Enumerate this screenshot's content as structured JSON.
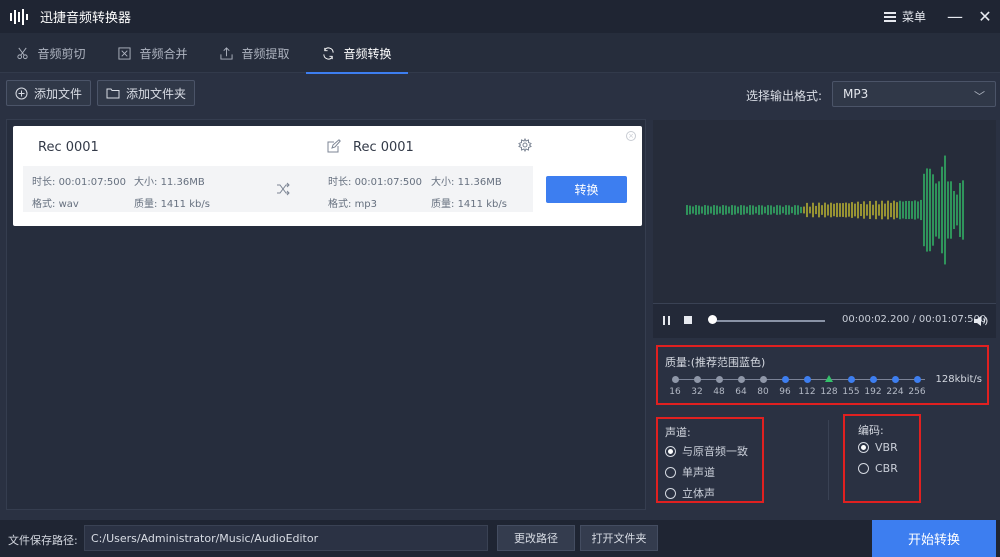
{
  "app": {
    "title": "迅捷音频转换器",
    "menu_label": "菜单",
    "minimize": "—",
    "close": "✕"
  },
  "tabs": [
    {
      "label": "音频剪切",
      "icon": "scissors-icon"
    },
    {
      "label": "音频合并",
      "icon": "merge-icon"
    },
    {
      "label": "音频提取",
      "icon": "extract-icon"
    },
    {
      "label": "音频转换",
      "icon": "convert-icon",
      "active": true
    }
  ],
  "toolbar": {
    "add_file": "添加文件",
    "add_folder": "添加文件夹",
    "format_label": "选择输出格式:",
    "format_value": "MP3"
  },
  "file": {
    "src_name": "Rec 0001",
    "dst_name": "Rec 0001",
    "src": {
      "duration_label": "时长:",
      "duration": "00:01:07:500",
      "size_label": "大小:",
      "size": "11.36MB",
      "format_label": "格式:",
      "format": "wav",
      "quality_label": "质量:",
      "quality": "1411 kb/s"
    },
    "dst": {
      "duration_label": "时长:",
      "duration": "00:01:07:500",
      "size_label": "大小:",
      "size": "11.36MB",
      "format_label": "格式:",
      "format": "mp3",
      "quality_label": "质量:",
      "quality": "1411 kb/s"
    },
    "convert_label": "转换"
  },
  "player": {
    "time": "00:00:02.200 / 00:01:07:500",
    "progress": 0.03
  },
  "quality": {
    "title": "质量:(推荐范围蓝色)",
    "current": "128kbit/s",
    "levels": [
      "16",
      "32",
      "48",
      "64",
      "80",
      "96",
      "112",
      "128",
      "155",
      "192",
      "224",
      "256"
    ],
    "selected_index": 7,
    "recommended_from_index": 5
  },
  "channel": {
    "title": "声道:",
    "options": [
      {
        "label": "与原音频一致",
        "checked": true
      },
      {
        "label": "单声道",
        "checked": false
      },
      {
        "label": "立体声",
        "checked": false
      }
    ]
  },
  "encoding": {
    "title": "编码:",
    "options": [
      {
        "label": "VBR",
        "checked": true
      },
      {
        "label": "CBR",
        "checked": false
      }
    ]
  },
  "bottom": {
    "path_label": "文件保存路径:",
    "path_value": "C:/Users/Administrator/Music/AudioEditor",
    "change_path": "更改路径",
    "open_folder": "打开文件夹",
    "start": "开始转换"
  },
  "colors": {
    "accent": "#3d7ef0",
    "highlight_box": "#e02020",
    "wave_green": "#34c06a",
    "wave_yellow": "#c8c030"
  }
}
